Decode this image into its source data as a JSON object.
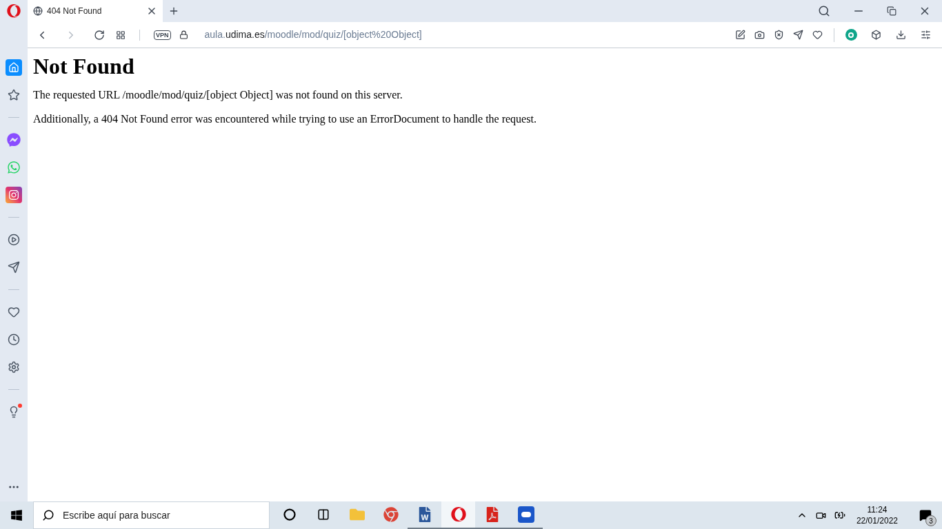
{
  "browser": {
    "tab": {
      "title": "404 Not Found",
      "selected": true
    },
    "vpn_badge": "VPN",
    "url": {
      "host_prefix": "aula.",
      "host": "udima.es",
      "path": "/moodle/mod/quiz/[object%20Object]"
    }
  },
  "sidebar": {
    "items": [
      {
        "kind": "home",
        "selected": true
      },
      {
        "kind": "star",
        "selected": false
      },
      {
        "kind": "divider"
      },
      {
        "kind": "messenger",
        "selected": false
      },
      {
        "kind": "whatsapp",
        "selected": false
      },
      {
        "kind": "instagram",
        "selected": false
      },
      {
        "kind": "divider"
      },
      {
        "kind": "player",
        "selected": false
      },
      {
        "kind": "send",
        "selected": false
      },
      {
        "kind": "divider"
      },
      {
        "kind": "heart",
        "selected": false
      },
      {
        "kind": "clock",
        "selected": false
      },
      {
        "kind": "settings",
        "selected": false
      },
      {
        "kind": "divider"
      },
      {
        "kind": "bulb",
        "selected": false,
        "notification": true
      }
    ]
  },
  "page": {
    "heading": "Not Found",
    "paragraphs": [
      "The requested URL /moodle/mod/quiz/[object Object] was not found on this server.",
      "Additionally, a 404 Not Found error was encountered while trying to use an ErrorDocument to handle the request."
    ]
  },
  "taskbar": {
    "search": {
      "placeholder": "Escribe aquí para buscar"
    },
    "apps": [
      {
        "kind": "cortana",
        "running": false,
        "selected": false
      },
      {
        "kind": "task-view",
        "running": false,
        "selected": false
      },
      {
        "kind": "explorer",
        "running": false,
        "selected": false
      },
      {
        "kind": "chrome",
        "running": false,
        "selected": false
      },
      {
        "kind": "word",
        "running": true,
        "selected": false
      },
      {
        "kind": "opera",
        "running": true,
        "selected": true
      },
      {
        "kind": "pdf",
        "running": true,
        "selected": false
      },
      {
        "kind": "remote",
        "running": true,
        "selected": false
      }
    ],
    "time": "11:24",
    "date": "22/01/2022",
    "notifications": "3"
  }
}
